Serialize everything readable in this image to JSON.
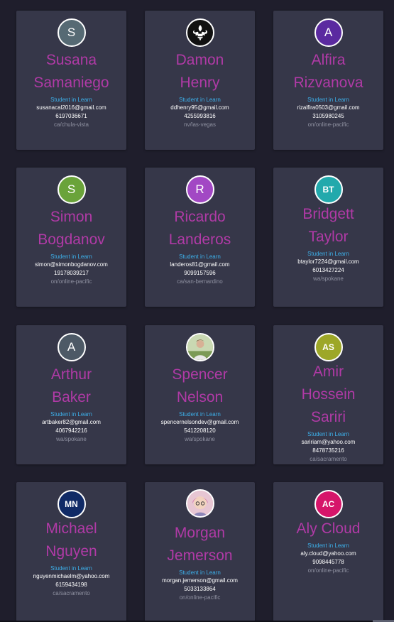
{
  "students": [
    {
      "name_line1": "Susana",
      "name_line2": "Samaniego",
      "name_line3": "",
      "initials": "S",
      "avatar_color": "#566a74",
      "avatar_type": "letter",
      "role": "Student in Learn",
      "email": "susanacal2016@gmail.com",
      "phone": "6197036671",
      "location": "ca/chula-vista"
    },
    {
      "name_line1": "Damon",
      "name_line2": "Henry",
      "name_line3": "",
      "initials": "",
      "avatar_color": "#111111",
      "avatar_type": "fleur-de-lis",
      "role": "Student in Learn",
      "email": "ddhenry95@gmail.com",
      "phone": "4255993816",
      "location": "nv/las-vegas"
    },
    {
      "name_line1": "Alfira",
      "name_line2": "Rizvanova",
      "name_line3": "",
      "initials": "A",
      "avatar_color": "#5b2aa0",
      "avatar_type": "letter",
      "role": "Student in Learn",
      "email": "rizalfira0503@gmail.com",
      "phone": "3105980245",
      "location": "on/online-pacific"
    },
    {
      "name_line1": "Simon",
      "name_line2": "Bogdanov",
      "name_line3": "",
      "initials": "S",
      "avatar_color": "#6aa33a",
      "avatar_type": "letter",
      "role": "Student in Learn",
      "email": "simon@simonbogdanov.com",
      "phone": "19178039217",
      "location": "on/online-pacific"
    },
    {
      "name_line1": "Ricardo",
      "name_line2": "Landeros",
      "name_line3": "",
      "initials": "R",
      "avatar_color": "#a248c4",
      "avatar_type": "letter",
      "role": "Student in Learn",
      "email": "landeros81@gmail.com",
      "phone": "9099157596",
      "location": "ca/san-bernardino"
    },
    {
      "name_line1": "Bridgett",
      "name_line2": "Taylor",
      "name_line3": "",
      "initials": "BT",
      "avatar_color": "#22a9ac",
      "avatar_type": "letter-small",
      "role": "Student in Learn",
      "email": "btaylor7224@gmail.com",
      "phone": "6013427224",
      "location": "wa/spokane"
    },
    {
      "name_line1": "Arthur",
      "name_line2": "Baker",
      "name_line3": "",
      "initials": "A",
      "avatar_color": "#4d5966",
      "avatar_type": "letter",
      "role": "Student in Learn",
      "email": "artbaker82@gmail.com",
      "phone": "4067942216",
      "location": "wa/spokane"
    },
    {
      "name_line1": "Spencer",
      "name_line2": "Nelson",
      "name_line3": "",
      "initials": "",
      "avatar_color": "#9fb07c",
      "avatar_type": "photo",
      "role": "Student in Learn",
      "email": "spencernelsondev@gmail.com",
      "phone": "5412208120",
      "location": "wa/spokane"
    },
    {
      "name_line1": "Amir",
      "name_line2": "Hossein",
      "name_line3": "Sariri",
      "initials": "AS",
      "avatar_color": "#9da728",
      "avatar_type": "letter-small",
      "role": "Student in Learn",
      "email": "saririam@yahoo.com",
      "phone": "8478735216",
      "location": "ca/sacramento"
    },
    {
      "name_line1": "Michael",
      "name_line2": "Nguyen",
      "name_line3": "",
      "initials": "MN",
      "avatar_color": "#102a66",
      "avatar_type": "letter-small",
      "role": "Student in Learn",
      "email": "nguyenmichaelm@yahoo.com",
      "phone": "6159434198",
      "location": "ca/sacramento"
    },
    {
      "name_line1": "Morgan",
      "name_line2": "Jemerson",
      "name_line3": "",
      "initials": "",
      "avatar_color": "#d9a7bc",
      "avatar_type": "photo",
      "role": "Student in Learn",
      "email": "morgan.jemerson@gmail.com",
      "phone": "5033133864",
      "location": "on/online-pacific"
    },
    {
      "name_line1": "Aly Cloud",
      "name_line2": "",
      "name_line3": "",
      "initials": "AC",
      "avatar_color": "#d6156a",
      "avatar_type": "letter-small",
      "role": "Student in Learn",
      "email": "aly.cloud@yahoo.com",
      "phone": "9098445778",
      "location": "on/online-pacific"
    }
  ]
}
